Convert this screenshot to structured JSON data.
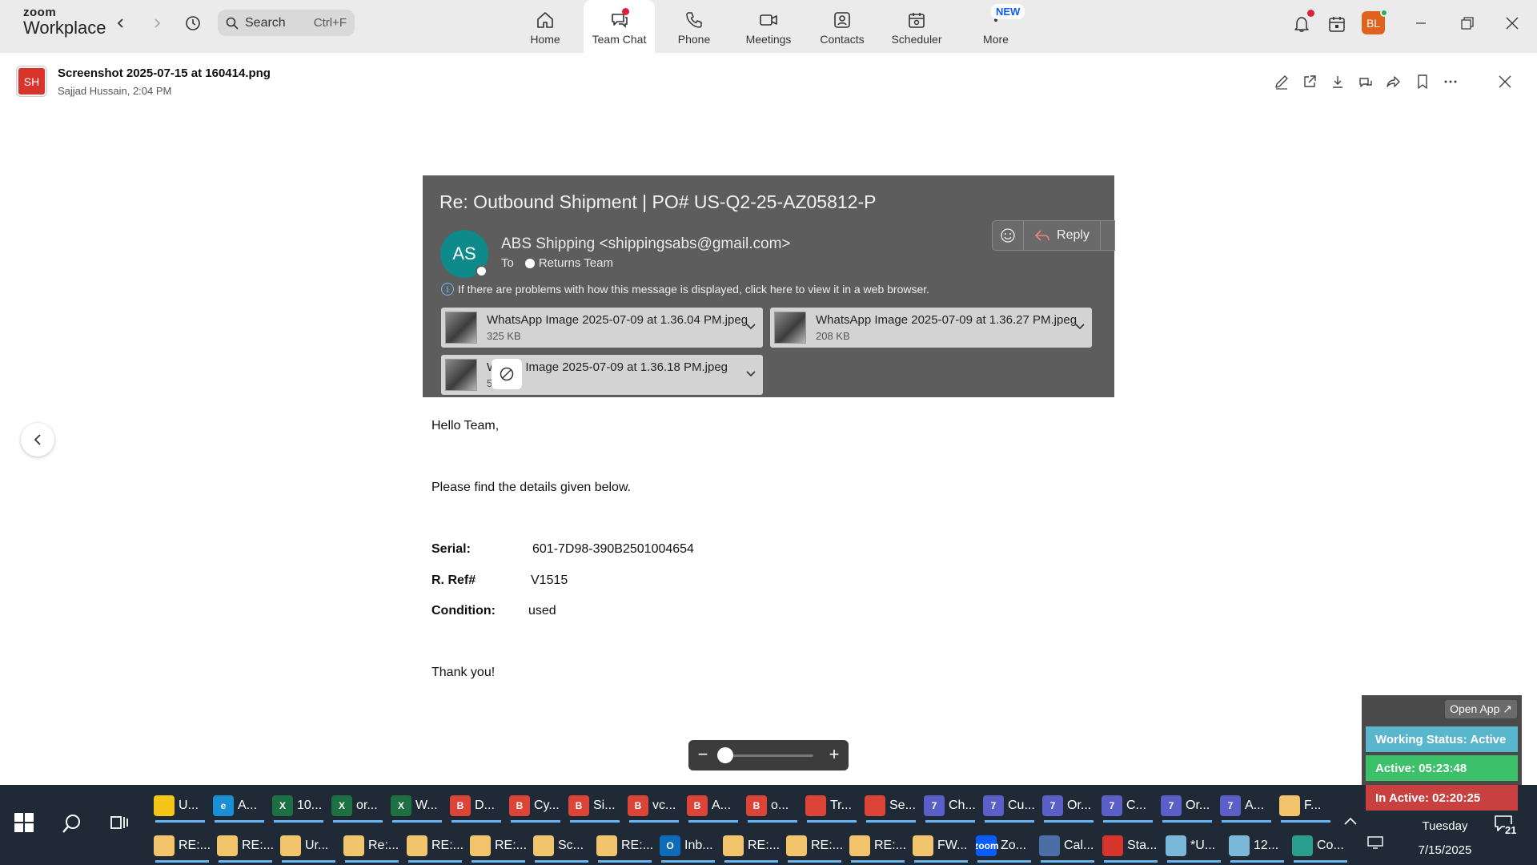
{
  "app": {
    "brand_top": "zoom",
    "brand_bottom": "Workplace"
  },
  "search": {
    "label": "Search",
    "shortcut": "Ctrl+F"
  },
  "nav_tabs": [
    {
      "label": "Home"
    },
    {
      "label": "Team Chat"
    },
    {
      "label": "Phone"
    },
    {
      "label": "Meetings"
    },
    {
      "label": "Contacts"
    },
    {
      "label": "Scheduler"
    },
    {
      "label": "More"
    }
  ],
  "new_badge": "NEW",
  "user": {
    "initials": "BL"
  },
  "file": {
    "avatar_initials": "SH",
    "name": "Screenshot 2025-07-15 at 160414.png",
    "meta": "Sajjad Hussain, 2:04 PM"
  },
  "email": {
    "subject": "Re: Outbound Shipment | PO# US-Q2-25-AZ05812-P",
    "avatar_initials": "AS",
    "sender": "ABS Shipping <shippingsabs@gmail.com>",
    "to_label": "To",
    "to_name": "Returns Team",
    "reply_label": "Reply",
    "info": "If there are problems with how this message is displayed, click here to view it in a web browser.",
    "attachments": [
      {
        "name": "WhatsApp Image 2025-07-09 at 1.36.04 PM.jpeg",
        "size": "325 KB"
      },
      {
        "name": "WhatsApp Image 2025-07-09 at 1.36.27 PM.jpeg",
        "size": "208 KB"
      },
      {
        "name": "W     App Image 2025-07-09 at 1.36.18 PM.jpeg",
        "size": "5"
      }
    ],
    "greeting": "Hello Team,",
    "intro": "Please find the details given below.",
    "serial_label": "Serial:",
    "serial_value": "601-7D98-390B2501004654",
    "ref_label": "R. Ref#",
    "ref_value": "V1515",
    "condition_label": "Condition:",
    "condition_value": "used",
    "closing": "Thank you!"
  },
  "status_widget": {
    "open_app": "Open App ↗",
    "working_status": "Working Status: Active",
    "active_time": "Active: 05:23:48",
    "inactive_time": "In Active: 02:20:25"
  },
  "taskbar": {
    "row1": [
      {
        "label": "U...",
        "icon": "folder-icon",
        "color": "#f5c518",
        "glyph": ""
      },
      {
        "label": "A...",
        "icon": "edge-icon",
        "color": "#1a8fd6",
        "glyph": "e"
      },
      {
        "label": "10...",
        "icon": "excel-icon",
        "color": "#1d7044",
        "glyph": "X"
      },
      {
        "label": "or...",
        "icon": "excel-icon",
        "color": "#1d7044",
        "glyph": "X"
      },
      {
        "label": "W...",
        "icon": "excel-icon",
        "color": "#1d7044",
        "glyph": "X"
      },
      {
        "label": "D...",
        "icon": "chrome-icon",
        "color": "#db4437",
        "glyph": "B"
      },
      {
        "label": "Cy...",
        "icon": "chrome-icon",
        "color": "#db4437",
        "glyph": "B"
      },
      {
        "label": "Si...",
        "icon": "chrome-icon",
        "color": "#db4437",
        "glyph": "B"
      },
      {
        "label": "vc...",
        "icon": "chrome-icon",
        "color": "#db4437",
        "glyph": "B"
      },
      {
        "label": "A...",
        "icon": "chrome-icon",
        "color": "#db4437",
        "glyph": "B"
      },
      {
        "label": "o...",
        "icon": "chrome-icon",
        "color": "#db4437",
        "glyph": "B"
      },
      {
        "label": "Tr...",
        "icon": "chrome-icon",
        "color": "#db4437",
        "glyph": ""
      },
      {
        "label": "Se...",
        "icon": "chrome-icon",
        "color": "#db4437",
        "glyph": ""
      },
      {
        "label": "Ch...",
        "icon": "teams-icon",
        "color": "#5b5fc7",
        "glyph": "7"
      },
      {
        "label": "Cu...",
        "icon": "teams-icon",
        "color": "#5b5fc7",
        "glyph": "7"
      },
      {
        "label": "Or...",
        "icon": "teams-icon",
        "color": "#5b5fc7",
        "glyph": "7"
      },
      {
        "label": "C...",
        "icon": "teams-icon",
        "color": "#5b5fc7",
        "glyph": "7"
      },
      {
        "label": "Or...",
        "icon": "teams-icon",
        "color": "#5b5fc7",
        "glyph": "7"
      },
      {
        "label": "A...",
        "icon": "teams-icon",
        "color": "#5b5fc7",
        "glyph": "7"
      },
      {
        "label": "F...",
        "icon": "mail-icon",
        "color": "#f2c46b",
        "glyph": ""
      }
    ],
    "row2": [
      {
        "label": "RE:...",
        "icon": "mail-icon",
        "color": "#f2c46b",
        "glyph": ""
      },
      {
        "label": "RE:...",
        "icon": "mail-icon",
        "color": "#f2c46b",
        "glyph": ""
      },
      {
        "label": "Ur...",
        "icon": "mail-icon",
        "color": "#f2c46b",
        "glyph": ""
      },
      {
        "label": "Re:...",
        "icon": "mail-icon",
        "color": "#f2c46b",
        "glyph": ""
      },
      {
        "label": "RE:...",
        "icon": "mail-icon",
        "color": "#f2c46b",
        "glyph": ""
      },
      {
        "label": "RE:...",
        "icon": "mail-icon",
        "color": "#f2c46b",
        "glyph": ""
      },
      {
        "label": "Sc...",
        "icon": "mail-icon",
        "color": "#f2c46b",
        "glyph": ""
      },
      {
        "label": "RE:...",
        "icon": "mail-icon",
        "color": "#f2c46b",
        "glyph": ""
      },
      {
        "label": "Inb...",
        "icon": "outlook-icon",
        "color": "#0f6cbd",
        "glyph": "O"
      },
      {
        "label": "RE:...",
        "icon": "mail-icon",
        "color": "#f2c46b",
        "glyph": ""
      },
      {
        "label": "RE:...",
        "icon": "mail-icon",
        "color": "#f2c46b",
        "glyph": ""
      },
      {
        "label": "RE:...",
        "icon": "mail-icon",
        "color": "#f2c46b",
        "glyph": ""
      },
      {
        "label": "FW...",
        "icon": "mail-icon",
        "color": "#f2c46b",
        "glyph": ""
      },
      {
        "label": "Zo...",
        "icon": "zoom-icon",
        "color": "#0b5cff",
        "glyph": "zoom"
      },
      {
        "label": "Cal...",
        "icon": "calculator-icon",
        "color": "#4a6fa5",
        "glyph": ""
      },
      {
        "label": "Sta...",
        "icon": "pdf-icon",
        "color": "#d9342b",
        "glyph": ""
      },
      {
        "label": "*U...",
        "icon": "notepad-icon",
        "color": "#7ab8d9",
        "glyph": ""
      },
      {
        "label": "12...",
        "icon": "notepad-icon",
        "color": "#7ab8d9",
        "glyph": ""
      },
      {
        "label": "Co...",
        "icon": "app-icon",
        "color": "#2a9d8f",
        "glyph": ""
      }
    ],
    "clock_day": "Tuesday",
    "clock_date": "7/15/2025",
    "notification_count": "21"
  }
}
